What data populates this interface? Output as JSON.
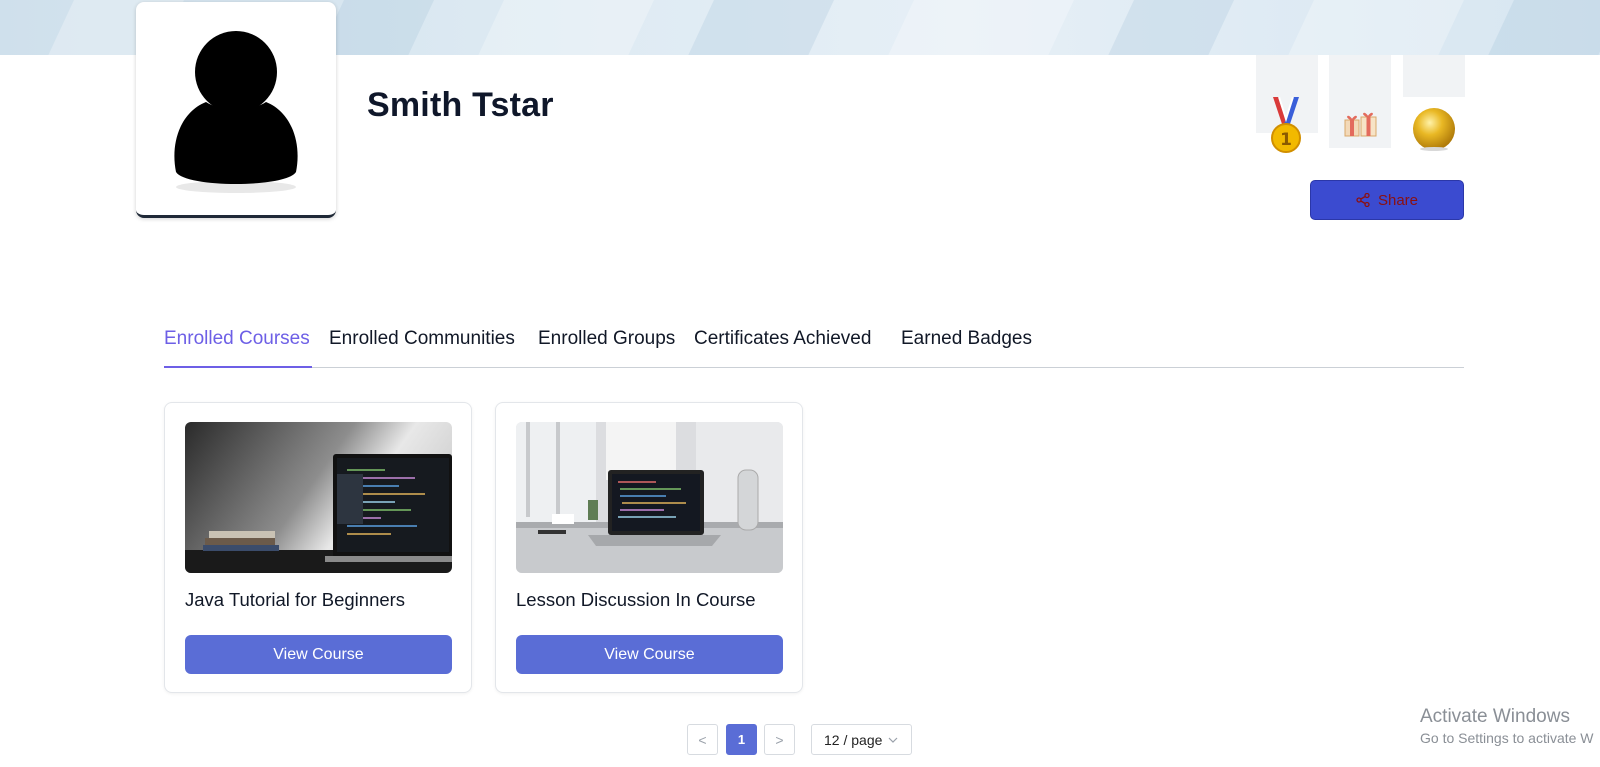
{
  "profile": {
    "name": "Smith Tstar",
    "avatar_icon": "user-silhouette-icon",
    "badges": [
      {
        "name": "medal-icon",
        "label": "1"
      },
      {
        "name": "gift-icon"
      },
      {
        "name": "gold-coin-icon"
      }
    ],
    "share_label": "Share",
    "share_icon": "share-icon"
  },
  "colors": {
    "accent": "#6d5fe6",
    "primary_button": "#5a6dd6",
    "share_button": "#3b4bd0"
  },
  "tabs": [
    {
      "label": "Enrolled Courses",
      "active": true
    },
    {
      "label": "Enrolled Communities",
      "active": false
    },
    {
      "label": "Enrolled Groups",
      "active": false
    },
    {
      "label": "Certificates Achieved",
      "active": false
    },
    {
      "label": "Earned Badges",
      "active": false
    }
  ],
  "courses": [
    {
      "title": "Java Tutorial for Beginners",
      "button": "View Course"
    },
    {
      "title": "Lesson Discussion In Course",
      "button": "View Course"
    }
  ],
  "pagination": {
    "prev": "<",
    "current": "1",
    "next": ">",
    "page_size": "12 / page"
  },
  "watermark": {
    "line1": "Activate Windows",
    "line2": "Go to Settings to activate W"
  }
}
